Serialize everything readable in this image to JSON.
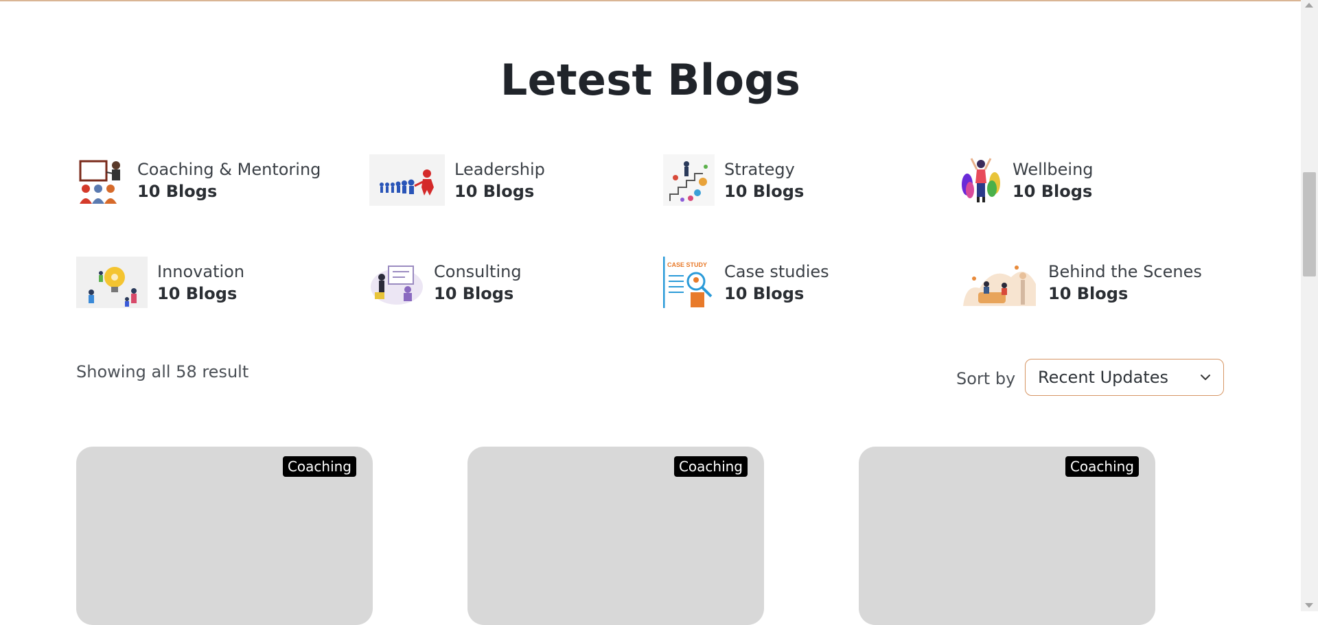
{
  "heading": "Letest Blogs",
  "categories": [
    {
      "name": "Coaching & Mentoring",
      "count": "10 Blogs",
      "icon": "coaching-mentoring-illustration"
    },
    {
      "name": "Leadership",
      "count": "10 Blogs",
      "icon": "leadership-illustration"
    },
    {
      "name": "Strategy",
      "count": "10 Blogs",
      "icon": "strategy-illustration"
    },
    {
      "name": "Wellbeing",
      "count": "10 Blogs",
      "icon": "wellbeing-illustration"
    },
    {
      "name": "Innovation",
      "count": "10 Blogs",
      "icon": "innovation-illustration"
    },
    {
      "name": "Consulting",
      "count": "10 Blogs",
      "icon": "consulting-illustration"
    },
    {
      "name": "Case studies",
      "count": "10 Blogs",
      "icon": "case-study-illustration",
      "icon_text": "CASE STUDY"
    },
    {
      "name": "Behind the Scenes",
      "count": "10 Blogs",
      "icon": "behind-the-scenes-illustration"
    }
  ],
  "results_text": "Showing all 58 result",
  "sort": {
    "label": "Sort by",
    "value": "Recent Updates"
  },
  "cards": [
    {
      "tag": "Coaching"
    },
    {
      "tag": "Coaching"
    },
    {
      "tag": "Coaching"
    }
  ],
  "colors": {
    "accent_border": "#d69563",
    "card_bg": "#d8d8d8",
    "tag_bg": "#000000"
  }
}
